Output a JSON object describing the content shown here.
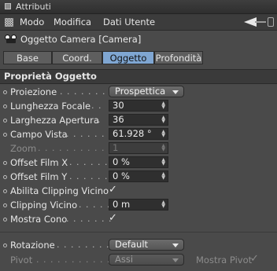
{
  "window": {
    "title": "Attributi"
  },
  "menu": {
    "items": [
      "Modo",
      "Modifica",
      "Dati Utente"
    ]
  },
  "object": {
    "name": "Oggetto Camera [Camera]"
  },
  "tabs": [
    "Base",
    "Coord.",
    "Oggetto",
    "Profondità"
  ],
  "active_tab": "Oggetto",
  "section": {
    "title": "Proprietà Oggetto"
  },
  "properties": {
    "proiezione": {
      "label": "Proiezione",
      "value": "Prospettica"
    },
    "lunghezza_focale": {
      "label": "Lunghezza Focale",
      "value": "30"
    },
    "larghezza_apertura": {
      "label": "Larghezza Apertura",
      "value": "36"
    },
    "campo_vista": {
      "label": "Campo Vista",
      "value": "61.928 °"
    },
    "zoom": {
      "label": "Zoom",
      "value": "1"
    },
    "offset_film_x": {
      "label": "Offset Film X",
      "value": "0 %"
    },
    "offset_film_y": {
      "label": "Offset Film Y",
      "value": "0 %"
    },
    "abilita_clipping_vicino": {
      "label": "Abilita Clipping Vicino",
      "checked": true
    },
    "clipping_vicino": {
      "label": "Clipping Vicino",
      "value": "0 m"
    },
    "mostra_cono": {
      "label": "Mostra Cono",
      "checked": true
    },
    "rotazione": {
      "label": "Rotazione",
      "value": "Default"
    },
    "pivot": {
      "label": "Pivot",
      "value": "Assi"
    },
    "mostra_pivot": {
      "label": "Mostra Pivot",
      "checked": true
    }
  },
  "glyphs": {
    "check": "✓",
    "spin_up": "▲",
    "spin_down": "▼"
  }
}
